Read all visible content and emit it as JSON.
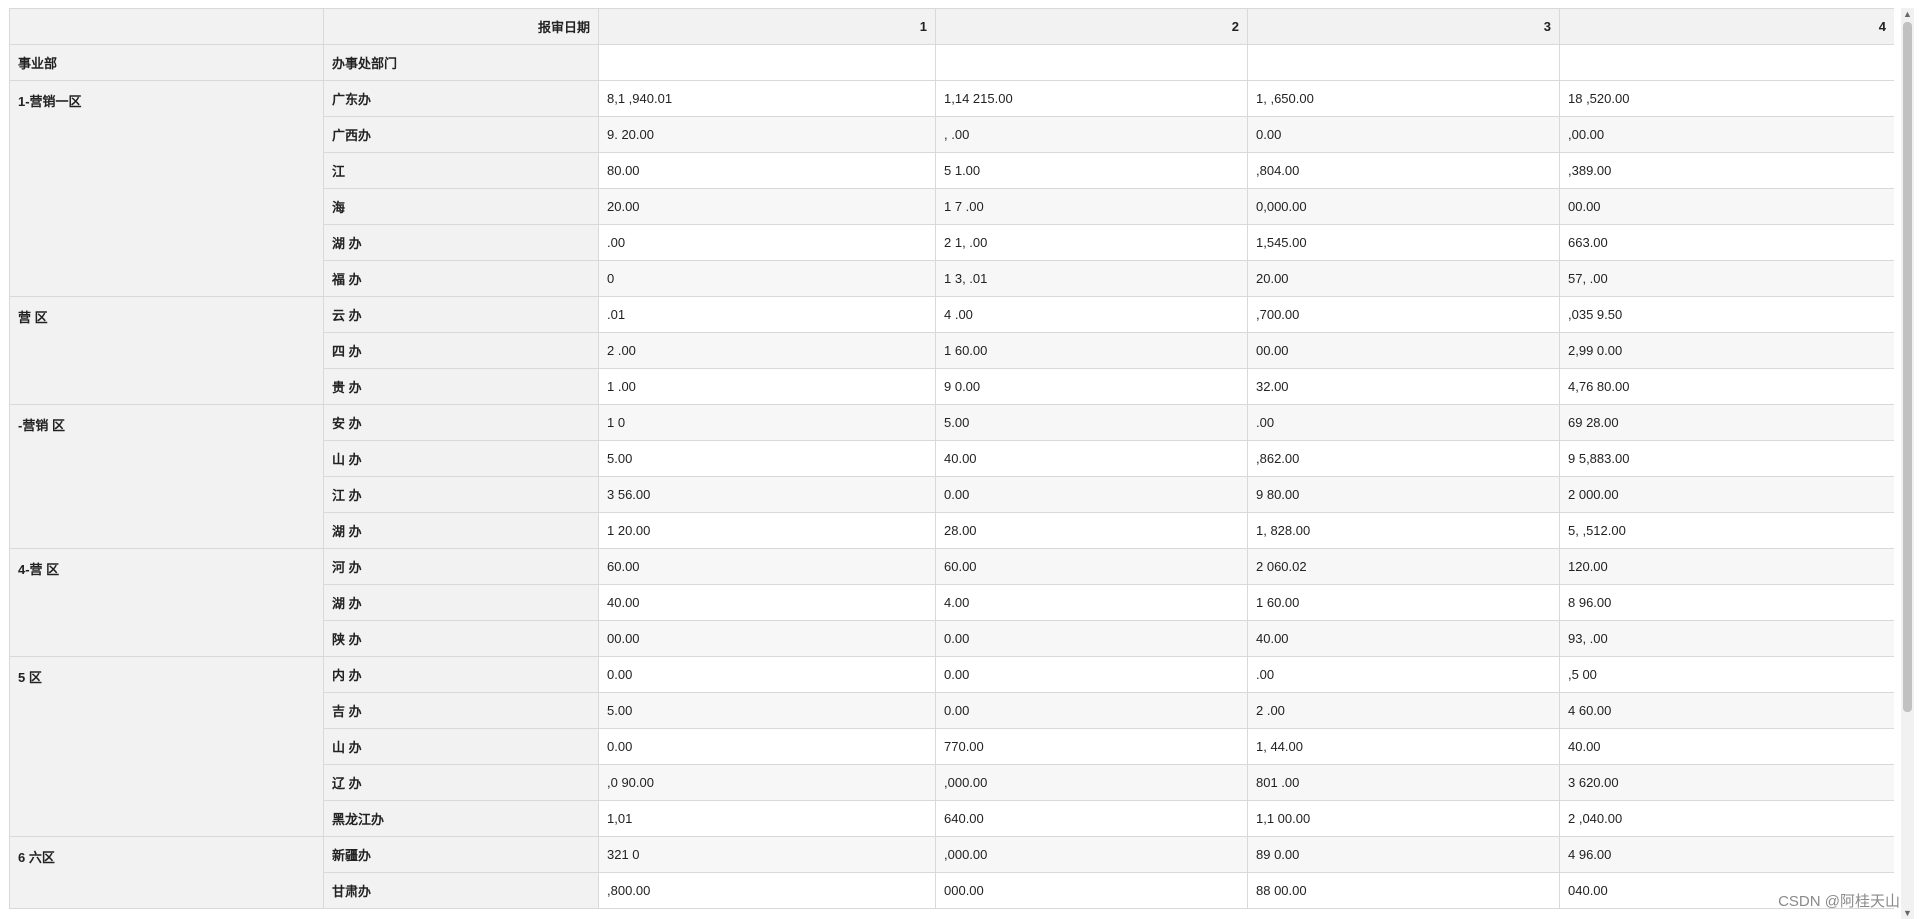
{
  "header": {
    "date_label": "报审日期",
    "columns": [
      "1",
      "2",
      "3",
      "4"
    ],
    "dept_label": "事业部",
    "office_label": "办事处部门"
  },
  "groups": [
    {
      "dept": "1-营销一区",
      "rows": [
        {
          "office": "广东办",
          "values": [
            "8,1  ,940.01",
            "1,14  215.00",
            "1,  ,650.00",
            "18  ,520.00"
          ]
        },
        {
          "office": "广西办",
          "values": [
            "9.   20.00",
            "  ,  .00",
            "   0.00",
            "   ,00.00"
          ]
        },
        {
          "office": "江  ",
          "values": [
            "  80.00",
            "  5  1.00",
            "  ,804.00",
            "  ,389.00"
          ]
        },
        {
          "office": "海  ",
          "values": [
            "  20.00",
            "1  7  .00",
            "  0,000.00",
            "  00.00"
          ]
        },
        {
          "office": "湖  办",
          "values": [
            "  .00",
            "2  1,  .00",
            "  1,545.00",
            "  663.00"
          ]
        },
        {
          "office": "福  办",
          "values": [
            "  0",
            "1  3,  .01",
            "  20.00",
            "57,  .00"
          ]
        }
      ]
    },
    {
      "dept": "  营  区",
      "rows": [
        {
          "office": "云  办",
          "values": [
            "  .01",
            "4  .00",
            "  ,700.00",
            ",035  9.50"
          ]
        },
        {
          "office": "四  办",
          "values": [
            "2  .00",
            "1  60.00",
            "  00.00",
            "2,99  0.00"
          ]
        },
        {
          "office": "贵  办",
          "values": [
            "1  .00",
            "9  0.00",
            "  32.00",
            "4,76  80.00"
          ]
        }
      ]
    },
    {
      "dept": "  -营销  区",
      "rows": [
        {
          "office": "安  办",
          "values": [
            "1  0",
            "  5.00",
            "  .00",
            "69  28.00"
          ]
        },
        {
          "office": "山  办",
          "values": [
            "  5.00",
            "  40.00",
            "  ,862.00",
            "9  5,883.00"
          ]
        },
        {
          "office": "江  办",
          "values": [
            "3  56.00",
            "  0.00",
            "9  80.00",
            "2  000.00"
          ]
        },
        {
          "office": "湖  办",
          "values": [
            "1  20.00",
            "  28.00",
            "1,  828.00",
            "5,  ,512.00"
          ]
        }
      ]
    },
    {
      "dept": "4-营  区",
      "rows": [
        {
          "office": "河  办",
          "values": [
            "  60.00",
            "  60.00",
            "2  060.02",
            "  120.00"
          ]
        },
        {
          "office": "湖  办",
          "values": [
            "  40.00",
            "  4.00",
            "1  60.00",
            "8  96.00"
          ]
        },
        {
          "office": "陕  办",
          "values": [
            "  00.00",
            "  0.00",
            "  40.00",
            "93,  .00"
          ]
        }
      ]
    },
    {
      "dept": "5  区",
      "rows": [
        {
          "office": "内  办",
          "values": [
            "  0.00",
            "  0.00",
            "  .00",
            "  ,5  00"
          ]
        },
        {
          "office": "吉  办",
          "values": [
            "  5.00",
            "  0.00",
            "2  .00",
            "  4  60.00"
          ]
        },
        {
          "office": "山  办",
          "values": [
            "  0.00",
            "  770.00",
            "1,  44.00",
            "  40.00"
          ]
        },
        {
          "office": "辽  办",
          "values": [
            "  ,0  90.00",
            "  ,000.00",
            "801  .00",
            "3  620.00"
          ]
        },
        {
          "office": "黑龙江办",
          "values": [
            "  1,01  ",
            "  640.00",
            "1,1  00.00",
            "2  ,040.00"
          ]
        }
      ]
    },
    {
      "dept": "6  六区",
      "rows": [
        {
          "office": "新疆办",
          "values": [
            "321  0",
            "  ,000.00",
            "89  0.00",
            "4  96.00"
          ]
        },
        {
          "office": "甘肃办",
          "values": [
            "  ,800.00",
            "  000.00",
            "88  00.00",
            "  040.00"
          ]
        }
      ]
    }
  ],
  "watermark": "CSDN @阿桂天山"
}
